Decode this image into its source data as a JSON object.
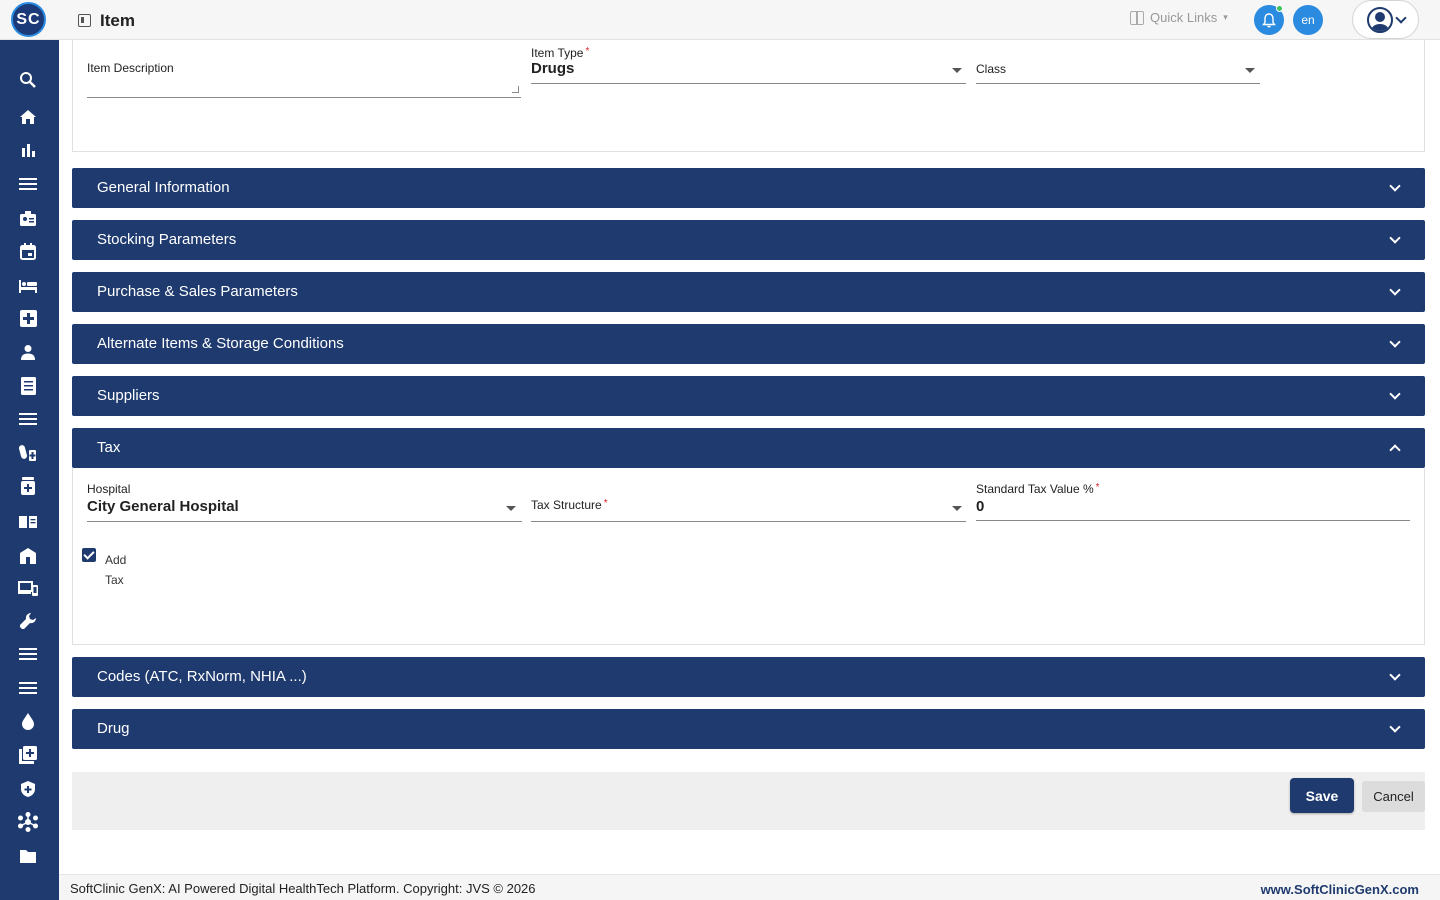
{
  "header": {
    "logo_text": "SC",
    "title": "Item",
    "quick_links": "Quick Links",
    "lang": "en"
  },
  "sidebar": {
    "icons": [
      "search-icon",
      "home-icon",
      "bar-chart-icon",
      "menu-icon",
      "badge-icon",
      "calendar-icon",
      "bed-icon",
      "medical-plus-icon",
      "person-icon",
      "document-icon",
      "menu-icon",
      "pharmacy-icon",
      "medicine-icon",
      "book-icon",
      "building-icon",
      "devices-icon",
      "wrench-icon",
      "menu-icon",
      "menu-icon",
      "drop-icon",
      "add-box-icon",
      "shield-icon",
      "hub-icon",
      "folder-icon"
    ]
  },
  "form": {
    "item_description_label": "Item Description",
    "item_type_label": "Item Type",
    "item_type_value": "Drugs",
    "class_label": "Class"
  },
  "sections": [
    {
      "title": "General Information"
    },
    {
      "title": "Stocking Parameters"
    },
    {
      "title": "Purchase & Sales Parameters"
    },
    {
      "title": "Alternate Items & Storage Conditions"
    },
    {
      "title": "Suppliers"
    },
    {
      "title": "Tax"
    },
    {
      "title": "Codes (ATC, RxNorm, NHIA ...)"
    },
    {
      "title": "Drug"
    }
  ],
  "tax": {
    "hospital_label": "Hospital",
    "hospital_value": "City General Hospital",
    "tax_structure_label": "Tax Structure",
    "std_tax_label": "Standard Tax Value %",
    "std_tax_value": "0",
    "add_tax_label": "Add Tax",
    "add_tax_checked": true
  },
  "actions": {
    "save": "Save",
    "cancel": "Cancel"
  },
  "footer": {
    "copyright": "SoftClinic GenX: AI Powered Digital HealthTech Platform. Copyright: JVS © 2026",
    "website": "www.SoftClinicGenX.com"
  },
  "colors": {
    "primary": "#1e3a6e",
    "accent": "#2a8be0"
  }
}
